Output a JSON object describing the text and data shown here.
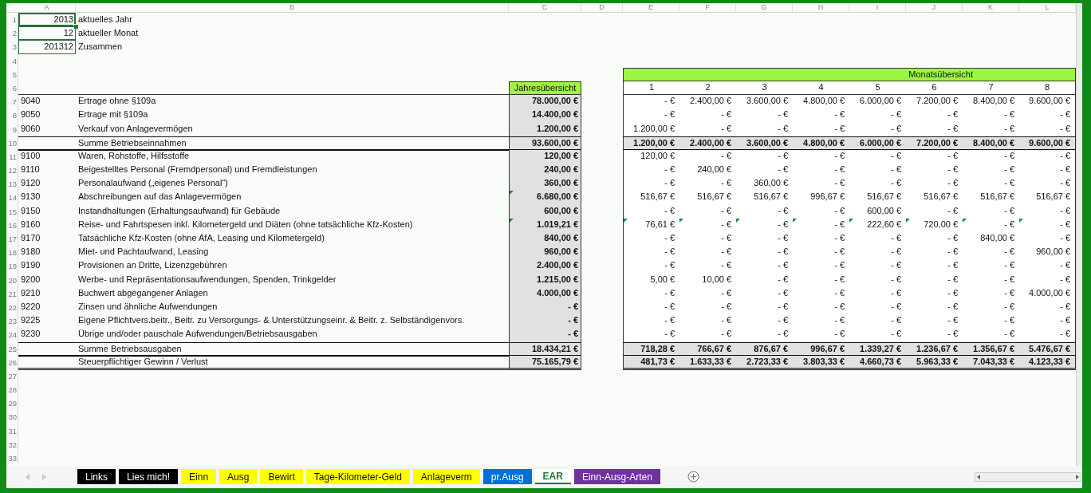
{
  "column_headers": [
    "A",
    "B",
    "C",
    "D",
    "E",
    "F",
    "G",
    "H",
    "I",
    "J",
    "K",
    "L"
  ],
  "row_numbers": [
    "1",
    "2",
    "3",
    "4",
    "5",
    "6",
    "7",
    "8",
    "9",
    "10",
    "11",
    "12",
    "13",
    "14",
    "15",
    "16",
    "17",
    "18",
    "19",
    "20",
    "21",
    "22",
    "23",
    "24",
    "25",
    "26",
    "27",
    "28",
    "29",
    "30",
    "31",
    "32",
    "33"
  ],
  "parameters": [
    {
      "column_a": "2013",
      "column_b": "aktuelles Jahr",
      "selected": true
    },
    {
      "column_a": "12",
      "column_b": "aktueller Monat",
      "selected": false
    },
    {
      "column_a": "201312",
      "column_b": "Zusammen",
      "selected": false
    }
  ],
  "monthly_header": "Monatsübersicht",
  "annual_header": "Jahresübersicht",
  "months": [
    "1",
    "2",
    "3",
    "4",
    "5",
    "6",
    "7",
    "8"
  ],
  "rows": [
    {
      "kind": "entry",
      "account": "9040",
      "description": "Ertrage ohne §109a",
      "annual": "78.000,00 €",
      "annual_flagged": false,
      "months_flagged": false,
      "months": [
        "- €",
        "2.400,00 €",
        "3.600,00 €",
        "4.800,00 €",
        "6.000,00 €",
        "7.200,00 €",
        "8.400,00 €",
        "9.600,00 €"
      ]
    },
    {
      "kind": "entry",
      "account": "9050",
      "description": "Ertrage mit §109a",
      "annual": "14.400,00 €",
      "annual_flagged": false,
      "months_flagged": false,
      "months": [
        "- €",
        "- €",
        "- €",
        "- €",
        "- €",
        "- €",
        "- €",
        "- €"
      ]
    },
    {
      "kind": "entry",
      "account": "9060",
      "description": "Verkauf von Anlagevermögen",
      "annual": "1.200,00 €",
      "annual_flagged": false,
      "months_flagged": false,
      "months": [
        "1.200,00 €",
        "- €",
        "- €",
        "- €",
        "- €",
        "- €",
        "- €",
        "- €"
      ]
    },
    {
      "kind": "sum",
      "description": "Summe Betriebseinnahmen",
      "annual": "93.600,00 €",
      "annual_flagged": false,
      "months_flagged": false,
      "months": [
        "1.200,00 €",
        "2.400,00 €",
        "3.600,00 €",
        "4.800,00 €",
        "6.000,00 €",
        "7.200,00 €",
        "8.400,00 €",
        "9.600,00 €"
      ]
    },
    {
      "kind": "entry",
      "account": "9100",
      "description": "Waren, Rohstoffe, Hilfsstoffe",
      "annual": "120,00 €",
      "annual_flagged": false,
      "months_flagged": false,
      "months": [
        "120,00 €",
        "- €",
        "- €",
        "- €",
        "- €",
        "- €",
        "- €",
        "- €"
      ]
    },
    {
      "kind": "entry",
      "account": "9110",
      "description": "Beigestelltes Personal (Fremdpersonal) und Fremdleistungen",
      "annual": "240,00 €",
      "annual_flagged": false,
      "months_flagged": false,
      "months": [
        "- €",
        "240,00 €",
        "- €",
        "- €",
        "- €",
        "- €",
        "- €",
        "- €"
      ]
    },
    {
      "kind": "entry",
      "account": "9120",
      "description": "Personalaufwand („eigenes Personal“)",
      "annual": "360,00 €",
      "annual_flagged": false,
      "months_flagged": false,
      "months": [
        "- €",
        "- €",
        "360,00 €",
        "- €",
        "- €",
        "- €",
        "- €",
        "- €"
      ]
    },
    {
      "kind": "entry",
      "account": "9130",
      "description": "Abschreibungen auf das Anlagevermögen",
      "annual": "6.680,00 €",
      "annual_flagged": true,
      "months_flagged": false,
      "months": [
        "516,67 €",
        "516,67 €",
        "516,67 €",
        "996,67 €",
        "516,67 €",
        "516,67 €",
        "516,67 €",
        "516,67 €"
      ]
    },
    {
      "kind": "entry",
      "account": "9150",
      "description": "Instandhaltungen (Erhaltungsaufwand) für Gebäude",
      "annual": "600,00 €",
      "annual_flagged": false,
      "months_flagged": false,
      "months": [
        "- €",
        "- €",
        "- €",
        "- €",
        "600,00 €",
        "- €",
        "- €",
        "- €"
      ]
    },
    {
      "kind": "entry",
      "account": "9160",
      "description": "Reise- und Fahrtspesen inkl. Kilometergeld und Diäten (ohne tatsächliche Kfz-Kosten)",
      "annual": "1.019,21 €",
      "annual_flagged": true,
      "months_flagged": true,
      "months": [
        "76,61 €",
        "- €",
        "- €",
        "- €",
        "222,60 €",
        "720,00 €",
        "- €",
        "- €"
      ]
    },
    {
      "kind": "entry",
      "account": "9170",
      "description": "Tatsächliche Kfz-Kosten (ohne AfA, Leasing und Kilometergeld)",
      "annual": "840,00 €",
      "annual_flagged": false,
      "months_flagged": false,
      "months": [
        "- €",
        "- €",
        "- €",
        "- €",
        "- €",
        "- €",
        "840,00 €",
        "- €"
      ]
    },
    {
      "kind": "entry",
      "account": "9180",
      "description": "Miet- und Pachtaufwand, Leasing",
      "annual": "960,00 €",
      "annual_flagged": false,
      "months_flagged": false,
      "months": [
        "- €",
        "- €",
        "- €",
        "- €",
        "- €",
        "- €",
        "- €",
        "960,00 €"
      ]
    },
    {
      "kind": "entry",
      "account": "9190",
      "description": "Provisionen an Dritte, Lizenzgebühren",
      "annual": "2.400,00 €",
      "annual_flagged": false,
      "months_flagged": false,
      "months": [
        "- €",
        "- €",
        "- €",
        "- €",
        "- €",
        "- €",
        "- €",
        "- €"
      ]
    },
    {
      "kind": "entry",
      "account": "9200",
      "description": "Werbe- und Repräsentationsaufwendungen, Spenden, Trinkgelder",
      "annual": "1.215,00 €",
      "annual_flagged": false,
      "months_flagged": false,
      "months": [
        "5,00 €",
        "10,00 €",
        "- €",
        "- €",
        "- €",
        "- €",
        "- €",
        "- €"
      ]
    },
    {
      "kind": "entry",
      "account": "9210",
      "description": "Buchwert abgegangener Anlagen",
      "annual": "4.000,00 €",
      "annual_flagged": false,
      "months_flagged": false,
      "months": [
        "- €",
        "- €",
        "- €",
        "- €",
        "- €",
        "- €",
        "- €",
        "4.000,00 €"
      ]
    },
    {
      "kind": "entry",
      "account": "9220",
      "description": "Zinsen und ähnliche Aufwendungen",
      "annual": "- €",
      "annual_flagged": false,
      "months_flagged": false,
      "months": [
        "- €",
        "- €",
        "- €",
        "- €",
        "- €",
        "- €",
        "- €",
        "- €"
      ]
    },
    {
      "kind": "entry",
      "account": "9225",
      "description": "Eigene Pflichtvers.beitr., Beitr. zu Versorgungs- & Unterstützungseinr. & Beitr. z. Selbständigenvors.",
      "annual": "- €",
      "annual_flagged": false,
      "months_flagged": false,
      "months": [
        "- €",
        "- €",
        "- €",
        "- €",
        "- €",
        "- €",
        "- €",
        "- €"
      ]
    },
    {
      "kind": "entry",
      "account": "9230",
      "description": "Übrige und/oder pauschale Aufwendungen/Betriebsausgaben",
      "annual": "- €",
      "annual_flagged": false,
      "months_flagged": false,
      "months": [
        "- €",
        "- €",
        "- €",
        "- €",
        "- €",
        "- €",
        "- €",
        "- €"
      ]
    },
    {
      "kind": "sum",
      "description": "Summe Betriebsausgaben",
      "annual": "18.434,21 €",
      "annual_flagged": false,
      "months_flagged": false,
      "months": [
        "718,28 €",
        "766,67 €",
        "876,67 €",
        "996,67 €",
        "1.339,27 €",
        "1.236,67 €",
        "1.356,67 €",
        "5.476,67 €"
      ]
    },
    {
      "kind": "total",
      "description": "Steuerpflichtiger Gewinn / Verlust",
      "annual": "75.165,79 €",
      "annual_flagged": false,
      "months_flagged": false,
      "months": [
        "481,73 €",
        "1.633,33 €",
        "2.723,33 €",
        "3.803,33 €",
        "4.660,73 €",
        "5.963,33 €",
        "7.043,33 €",
        "4.123,33 €"
      ]
    }
  ],
  "sheet_tabs": [
    {
      "label": "Links",
      "color": "#000000",
      "selected": false
    },
    {
      "label": "Lies mich!",
      "color": "#000000",
      "selected": false
    },
    {
      "label": "Einn",
      "color": "#ffff00",
      "selected": false
    },
    {
      "label": "Ausg",
      "color": "#ffff00",
      "selected": false
    },
    {
      "label": "Bewirt",
      "color": "#ffff00",
      "selected": false
    },
    {
      "label": "Tage-Kilometer-Geld",
      "color": "#ffff00",
      "selected": false
    },
    {
      "label": "Anlageverm",
      "color": "#ffff00",
      "selected": false
    },
    {
      "label": "pr.Ausg",
      "color": "#0070d8",
      "selected": false
    },
    {
      "label": "EAR",
      "color": "#ffffff",
      "selected": true
    },
    {
      "label": "Einn-Ausg-Arten",
      "color": "#7030a0",
      "selected": false
    }
  ]
}
